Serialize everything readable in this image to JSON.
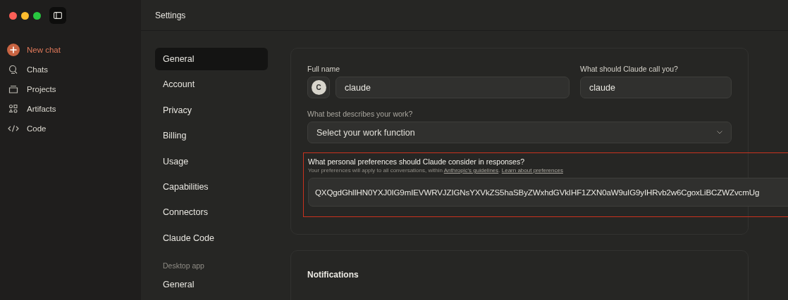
{
  "window": {
    "title": "Settings"
  },
  "sidebar": {
    "items": [
      {
        "label": "New chat",
        "kind": "primary"
      },
      {
        "label": "Chats",
        "kind": "chats"
      },
      {
        "label": "Projects",
        "kind": "projects"
      },
      {
        "label": "Artifacts",
        "kind": "artifacts"
      },
      {
        "label": "Code",
        "kind": "code"
      }
    ]
  },
  "settings_nav": {
    "items": [
      {
        "label": "General",
        "selected": true
      },
      {
        "label": "Account",
        "selected": false
      },
      {
        "label": "Privacy",
        "selected": false
      },
      {
        "label": "Billing",
        "selected": false
      },
      {
        "label": "Usage",
        "selected": false
      },
      {
        "label": "Capabilities",
        "selected": false
      },
      {
        "label": "Connectors",
        "selected": false
      },
      {
        "label": "Claude Code",
        "selected": false
      }
    ],
    "section": {
      "title": "Desktop app",
      "items": [
        {
          "label": "General",
          "selected": false
        }
      ]
    }
  },
  "profile": {
    "full_name": {
      "label": "Full name",
      "avatar": "C",
      "value": "claude"
    },
    "call_name": {
      "label": "What should Claude call you?",
      "value": "claude"
    },
    "work": {
      "label": "What best describes your work?",
      "placeholder": "Select your work function"
    },
    "preferences": {
      "label": "What personal preferences should Claude consider in responses?",
      "highlighted": true,
      "hint": [
        {
          "kind": "text",
          "text": "Your preferences will apply to all conversations, within "
        },
        {
          "kind": "link",
          "text": "Anthropic's guidelines"
        },
        {
          "kind": "text",
          "text": ". "
        },
        {
          "kind": "link",
          "text": "Learn about preferences"
        }
      ],
      "value": "QXQgdGhlIHN0YXJ0IG9mIEVWRVJZIGNsYXVkZS5haSByZWxhdGVkIHF1ZXN0aW9uIG9yIHRvb2w6CgoxLiBCZWZvcmUg"
    }
  },
  "notifications": {
    "title": "Notifications"
  }
}
